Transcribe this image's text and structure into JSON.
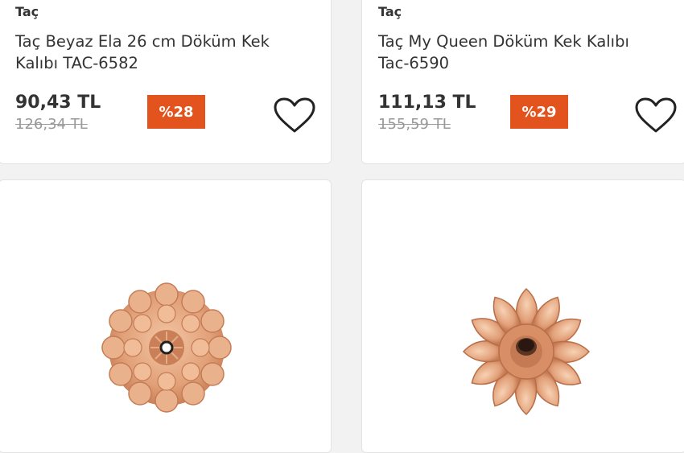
{
  "products": [
    {
      "brand": "Taç",
      "title": "Taç Beyaz Ela 26 cm Döküm Kek Kalıbı TAC-6582",
      "price": "90,43 TL",
      "old_price": "126,34 TL",
      "discount": "%28",
      "icon": "heart-icon"
    },
    {
      "brand": "Taç",
      "title": "Taç My Queen Döküm Kek Kalıbı Tac-6590",
      "price": "111,13 TL",
      "old_price": "155,59 TL",
      "discount": "%29",
      "icon": "heart-icon"
    }
  ],
  "colors": {
    "badge": "#e2531e",
    "text": "#333333",
    "old_price": "#999999",
    "mold": "#e5a37c"
  }
}
